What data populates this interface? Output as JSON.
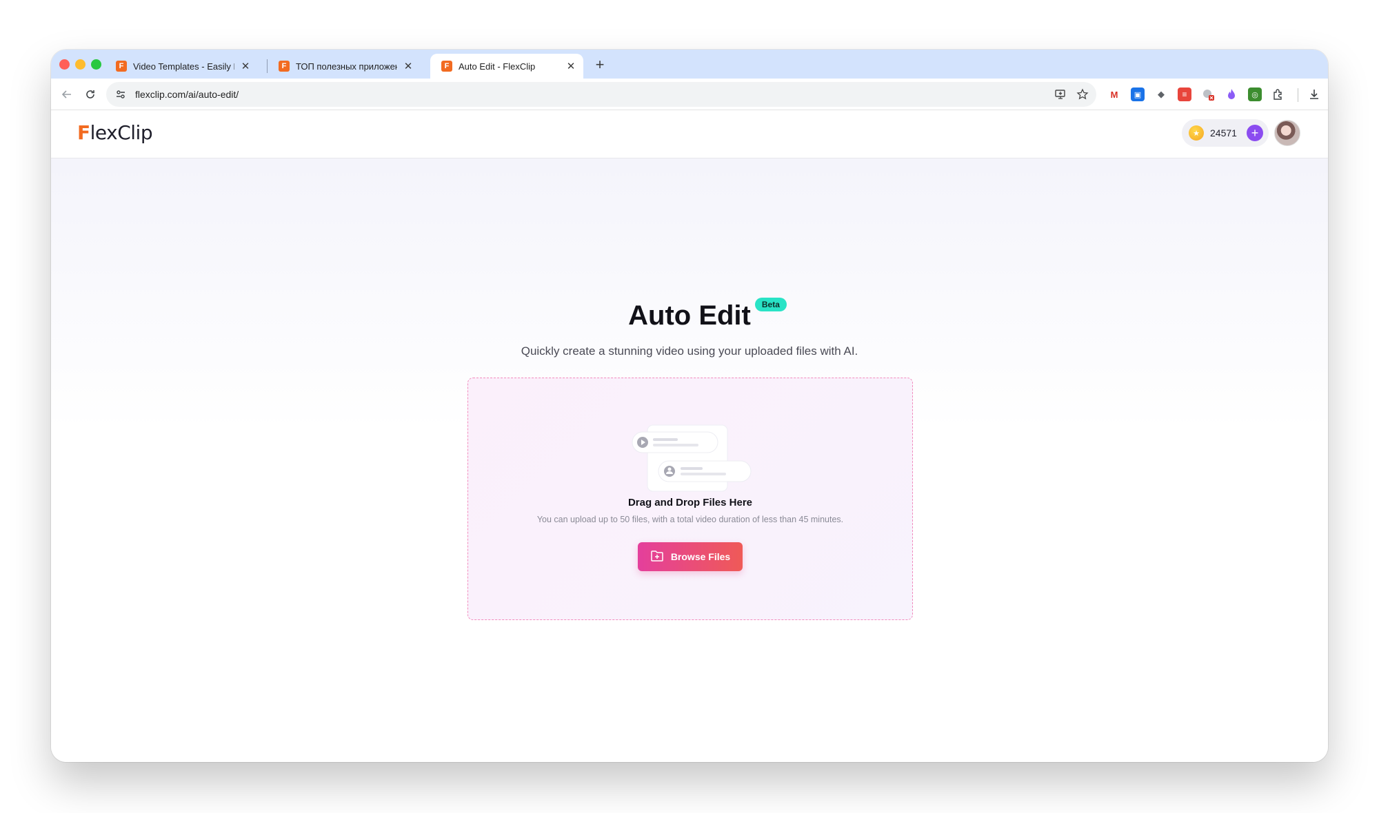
{
  "browser": {
    "tabs": [
      {
        "title": "Video Templates - Easily Mak",
        "favicon": "F",
        "active": false
      },
      {
        "title": "ТОП полезных приложений",
        "favicon": "F",
        "active": false
      },
      {
        "title": "Auto Edit - FlexClip",
        "favicon": "F",
        "active": true
      }
    ],
    "tab_close_glyph": "✕",
    "new_tab_glyph": "+",
    "url": "flexclip.com/ai/auto-edit/"
  },
  "header": {
    "logo_f": "F",
    "logo_rest": "lexClip",
    "credits": "24571",
    "credit_add_glyph": "+"
  },
  "hero": {
    "title": "Auto Edit",
    "badge": "Beta",
    "subtitle": "Quickly create a stunning video using your uploaded files with AI."
  },
  "upload": {
    "title": "Drag and Drop Files Here",
    "hint": "You can upload up to 50 files, with a total video duration of less than 45 minutes.",
    "button_label": "Browse Files"
  },
  "colors": {
    "accent_gradient_start": "#e43f9c",
    "accent_gradient_end": "#ef5a57",
    "brand_orange": "#f26b21",
    "badge_teal": "#29e3c6",
    "credit_purple": "#8b4cf0"
  }
}
